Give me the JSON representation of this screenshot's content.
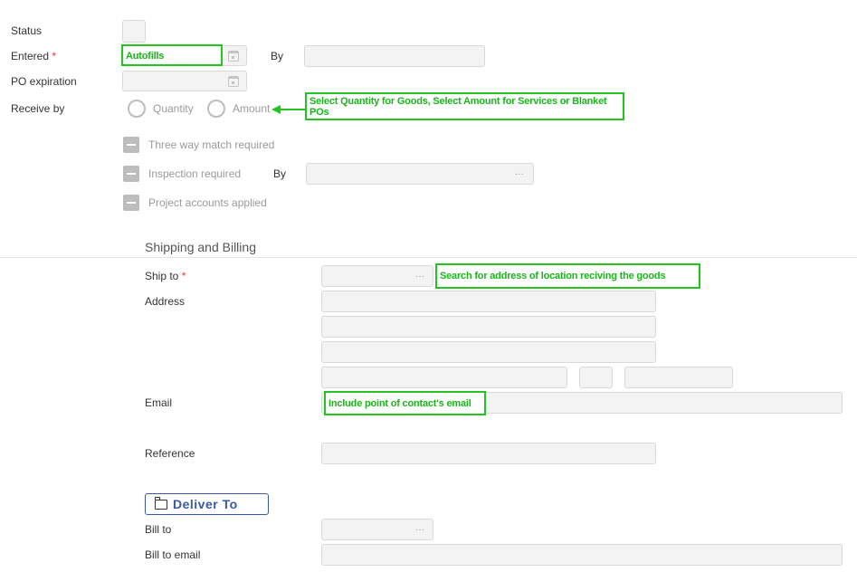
{
  "form": {
    "status_label": "Status",
    "entered_label": "Entered",
    "required_mark": "*",
    "by_label": "By",
    "po_expiration_label": "PO expiration",
    "receive_by_label": "Receive by",
    "receive_options": [
      "Quantity",
      "Amount"
    ],
    "three_way_label": "Three way match required",
    "inspection_label": "Inspection required",
    "inspection_by_label": "By",
    "project_accounts_label": "Project accounts applied",
    "ellipsis": "···"
  },
  "shipping": {
    "title": "Shipping and Billing",
    "ship_to_label": "Ship to",
    "address_label": "Address",
    "email_label": "Email",
    "reference_label": "Reference",
    "deliver_to_label": "Deliver To",
    "bill_to_label": "Bill to",
    "bill_to_email_label": "Bill to email"
  },
  "annotations": {
    "autofills": "Autofills",
    "receive_note": "Select Quantity for Goods, Select Amount for Services or Blanket POs",
    "ship_note": "Search for address of location reciving the goods",
    "email_note": "Include point of contact's email"
  },
  "colors": {
    "annotation_green": "#21c421",
    "required_red": "#e53935",
    "deliver_blue": "#3a57a8",
    "field_bg": "#f3f3f3"
  }
}
